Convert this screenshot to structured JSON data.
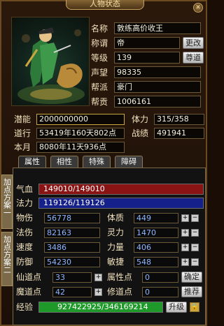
{
  "window": {
    "title": "人物状态",
    "close_label": "✕"
  },
  "profile": {
    "name_label": "名称",
    "name": "敦练高价收王",
    "title_label": "称谓",
    "title": "帝",
    "change_button": "更改",
    "level_label": "等级",
    "level": "139",
    "guide_button": "尊道",
    "prestige_label": "声望",
    "prestige": "98335",
    "faction_label": "帮派",
    "faction": "豪门",
    "contribution_label": "帮贡",
    "contribution": "1006161"
  },
  "summary": {
    "potential_label": "潜能",
    "potential": "2000000000",
    "stamina_label": "体力",
    "stamina": "315/358",
    "daoxing_label": "道行",
    "daoxing": "53419年160天802点",
    "combat_label": "战绩",
    "combat": "491941",
    "month_label": "本月",
    "month": "8080年11天936点"
  },
  "tabs": [
    "属性",
    "相性",
    "特殊",
    "障碍"
  ],
  "side_tabs": [
    "加点方案一",
    "加点方案二"
  ],
  "bars": {
    "hp_label": "气血",
    "hp": "149010/149010",
    "mp_label": "法力",
    "mp": "119126/119126"
  },
  "stats": {
    "phys_atk_label": "物伤",
    "phys_atk": "56778",
    "mag_atk_label": "法伤",
    "mag_atk": "82163",
    "speed_label": "速度",
    "speed": "3486",
    "defense_label": "防御",
    "defense": "54230",
    "constitution_label": "体质",
    "constitution": "449",
    "spirit_label": "灵力",
    "spirit": "1470",
    "strength_label": "力量",
    "strength": "406",
    "agility_label": "敏捷",
    "agility": "548",
    "immortal_label": "仙道点",
    "immortal": "33",
    "attr_points_label": "属性点",
    "attr_points": "0",
    "demon_label": "魔道点",
    "demon": "42",
    "practice_points_label": "修道点",
    "practice_points": "0",
    "exp_label": "经验",
    "exp": "927422925/346169214",
    "exp_fraction": 1.0
  },
  "buttons": {
    "confirm": "确定",
    "recommend": "推荐",
    "upgrade": "升级"
  },
  "colors": {
    "hp_bar": "#8a1414",
    "mp_bar": "#16208a",
    "exp_bar": "#1f9a2a"
  }
}
